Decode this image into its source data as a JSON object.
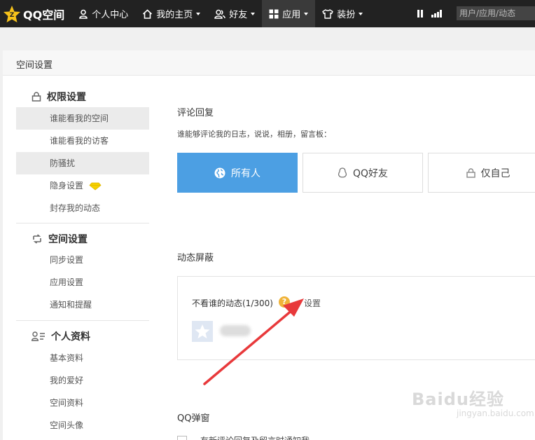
{
  "topbar": {
    "logo_text": "QQ空间",
    "nav": [
      {
        "label": "个人中心",
        "icon": "person-icon",
        "has_caret": false
      },
      {
        "label": "我的主页",
        "icon": "home-icon",
        "has_caret": true
      },
      {
        "label": "好友",
        "icon": "friends-icon",
        "has_caret": true
      },
      {
        "label": "应用",
        "icon": "apps-grid-icon",
        "has_caret": true,
        "active": true
      },
      {
        "label": "装扮",
        "icon": "tshirt-icon",
        "has_caret": true
      }
    ],
    "search_placeholder": "用户/应用/动态"
  },
  "panel": {
    "title": "空间设置"
  },
  "sidebar": {
    "groups": [
      {
        "title": "权限设置",
        "icon": "lock-icon",
        "items": [
          "谁能看我的空间",
          "谁能看我的访客",
          "防骚扰",
          "隐身设置",
          "封存我的动态"
        ]
      },
      {
        "title": "空间设置",
        "icon": "sync-icon",
        "items": [
          "同步设置",
          "应用设置",
          "通知和提醒"
        ]
      },
      {
        "title": "个人资料",
        "icon": "profile-icon",
        "items": [
          "基本资料",
          "我的爱好",
          "空间资料",
          "空间头像"
        ]
      }
    ]
  },
  "comment": {
    "title": "评论回复",
    "desc": "谁能够评论我的日志，说说，相册，留言板：",
    "options": [
      {
        "label": "所有人",
        "icon": "globe-icon",
        "selected": true
      },
      {
        "label": "QQ好友",
        "icon": "qq-penguin-icon",
        "selected": false
      },
      {
        "label": "仅自己",
        "icon": "lock-icon",
        "selected": false
      }
    ]
  },
  "feed_block": {
    "title": "动态屏蔽",
    "label": "不看谁的动态(1/300)",
    "help": "?",
    "link": "设置"
  },
  "popup": {
    "title": "QQ弹窗",
    "option": "有新评论回复及留言时通知我"
  },
  "watermark": {
    "main": "Baidu经验",
    "sub": "jingyan.baidu.com"
  },
  "colors": {
    "topbar": "#222222",
    "selected_option": "#4c9fe3",
    "annotation_arrow": "#e8393b",
    "vip_diamond": "#f5d000"
  }
}
